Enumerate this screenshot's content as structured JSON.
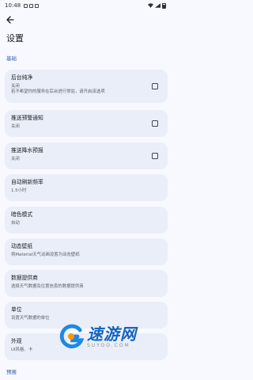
{
  "status_bar": {
    "time": "10:48"
  },
  "header": {
    "title": "设置"
  },
  "sections": {
    "basic": "基础",
    "forecast": "预报"
  },
  "settings": [
    {
      "title": "后台纯净",
      "desc": "关闭\n若不希望你的服务在后台进行常驻，请开启该选项",
      "has_checkbox": true
    },
    {
      "title": "推送预警通知",
      "desc": "关闭",
      "has_checkbox": true
    },
    {
      "title": "推送降水预报",
      "desc": "关闭",
      "has_checkbox": true
    },
    {
      "title": "自动刷新频率",
      "desc": "1.5小时",
      "has_checkbox": false
    },
    {
      "title": "暗色模式",
      "desc": "自动",
      "has_checkbox": false
    },
    {
      "title": "动态壁纸",
      "desc": "将Material天气动画设置为动态壁纸",
      "has_checkbox": false
    },
    {
      "title": "数据提供商",
      "desc": "选择天气数据及位置信息的数据提供商",
      "has_checkbox": false
    },
    {
      "title": "单位",
      "desc": "设置天气数据的单位",
      "has_checkbox": false
    },
    {
      "title": "外观",
      "desc": "UI风格、卡",
      "has_checkbox": false
    }
  ],
  "watermark": {
    "brand": "速游网",
    "sub": "SUYOO.COM"
  },
  "colors": {
    "accent": "#3a5ba9",
    "card_bg": "#e9eef8",
    "page_bg": "#f7f9ff",
    "watermark_blue": "#1565c0"
  },
  "icons": {
    "back": "arrow-left-icon",
    "menu": "more-vert-icon"
  }
}
